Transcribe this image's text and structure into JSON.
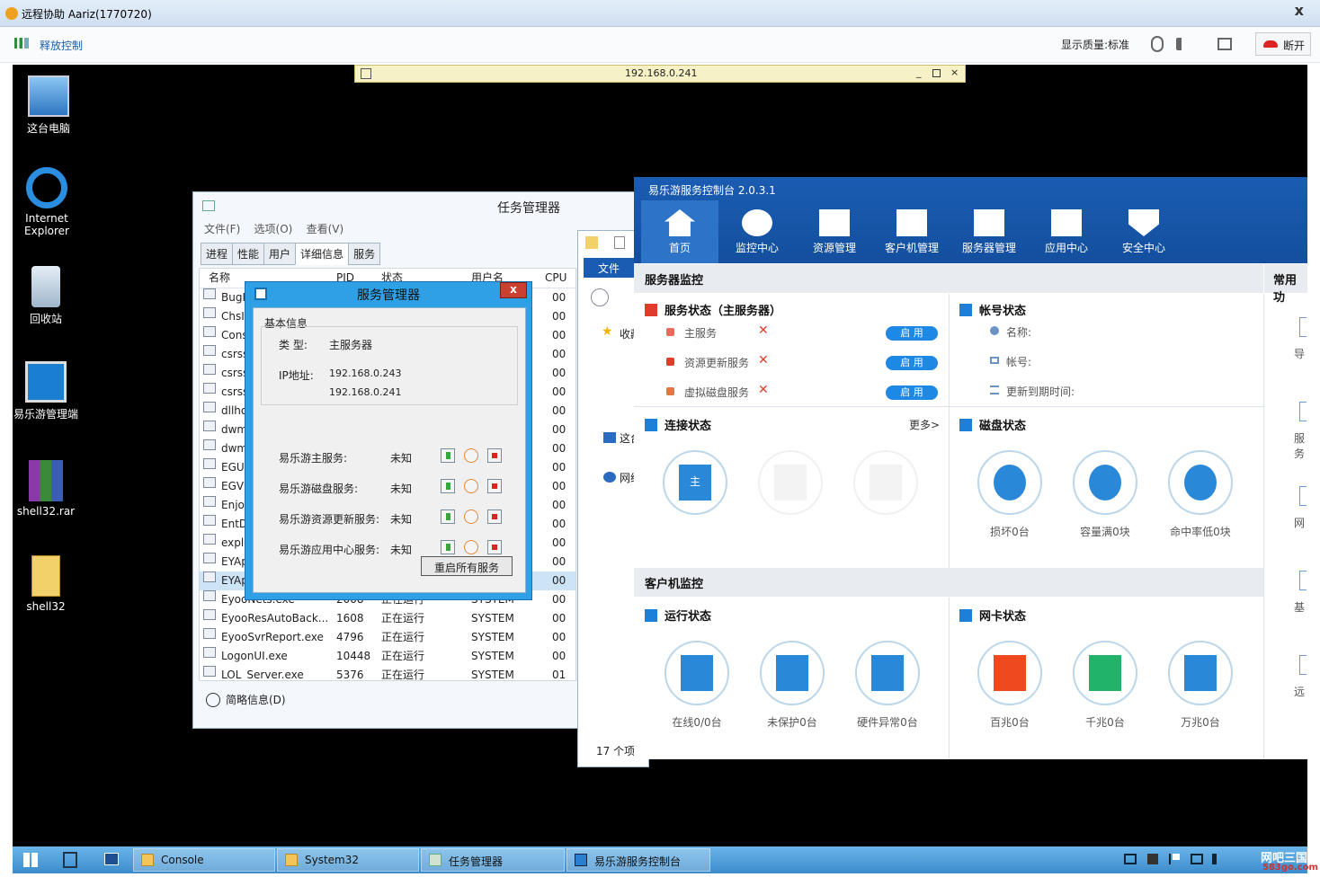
{
  "outer": {
    "title": "远程协助 Aariz(1770720)",
    "release_control": "释放控制",
    "quality": "显示质量:标准",
    "disconnect": "断开",
    "close": "x"
  },
  "remote_bar": {
    "address": "192.168.0.241"
  },
  "desktop_icons": [
    {
      "label": "这台电脑"
    },
    {
      "label": "Internet Explorer"
    },
    {
      "label": "回收站"
    },
    {
      "label": "易乐游管理端"
    },
    {
      "label": "shell32.rar"
    },
    {
      "label": "shell32"
    }
  ],
  "taskbar": {
    "items": [
      "Console",
      "System32",
      "任务管理器",
      "易乐游服务控制台"
    ],
    "watermark": "网吧三国",
    "watermark_url": "583go.com"
  },
  "task_manager": {
    "title": "任务管理器",
    "menu": [
      "文件(F)",
      "选项(O)",
      "查看(V)"
    ],
    "tabs": [
      "进程",
      "性能",
      "用户",
      "详细信息",
      "服务"
    ],
    "columns": [
      "名称",
      "PID",
      "状态",
      "用户名",
      "CPU"
    ],
    "rows": [
      {
        "name": "BugR",
        "pid": "",
        "status": "",
        "user": "",
        "cpu": "00"
      },
      {
        "name": "ChsII",
        "pid": "",
        "status": "",
        "user": "",
        "cpu": "00"
      },
      {
        "name": "Cons",
        "pid": "",
        "status": "",
        "user": "",
        "cpu": "00"
      },
      {
        "name": "csrss",
        "pid": "",
        "status": "",
        "user": "",
        "cpu": "00"
      },
      {
        "name": "csrss",
        "pid": "",
        "status": "",
        "user": "",
        "cpu": "00"
      },
      {
        "name": "csrss",
        "pid": "",
        "status": "",
        "user": "",
        "cpu": "00"
      },
      {
        "name": "dllho",
        "pid": "",
        "status": "",
        "user": "",
        "cpu": "00"
      },
      {
        "name": "dwm",
        "pid": "",
        "status": "",
        "user": "",
        "cpu": "00"
      },
      {
        "name": "dwm",
        "pid": "",
        "status": "",
        "user": "",
        "cpu": "00"
      },
      {
        "name": "EGUI",
        "pid": "",
        "status": "",
        "user": "",
        "cpu": "00"
      },
      {
        "name": "EGVi",
        "pid": "",
        "status": "",
        "user": "",
        "cpu": "00"
      },
      {
        "name": "Enjoy",
        "pid": "",
        "status": "",
        "user": "",
        "cpu": "00"
      },
      {
        "name": "EntD",
        "pid": "",
        "status": "",
        "user": "",
        "cpu": "00"
      },
      {
        "name": "explo",
        "pid": "",
        "status": "",
        "user": "",
        "cpu": "00"
      },
      {
        "name": "EYAp",
        "pid": "",
        "status": "",
        "user": "",
        "cpu": "00"
      },
      {
        "name": "EYAp",
        "pid": "",
        "status": "",
        "user": "",
        "cpu": "00"
      },
      {
        "name": "EyooNets.exe",
        "pid": "2008",
        "status": "正在运行",
        "user": "SYSTEM",
        "cpu": "00"
      },
      {
        "name": "EyooResAutoBack...",
        "pid": "1608",
        "status": "正在运行",
        "user": "SYSTEM",
        "cpu": "00"
      },
      {
        "name": "EyooSvrReport.exe",
        "pid": "4796",
        "status": "正在运行",
        "user": "SYSTEM",
        "cpu": "00"
      },
      {
        "name": "LogonUI.exe",
        "pid": "10448",
        "status": "正在运行",
        "user": "SYSTEM",
        "cpu": "00"
      },
      {
        "name": "LOL_Server.exe",
        "pid": "5376",
        "status": "正在运行",
        "user": "SYSTEM",
        "cpu": "01"
      }
    ],
    "footer": "简略信息(D)"
  },
  "service_manager": {
    "title": "服务管理器",
    "close": "x",
    "group_title": "基本信息",
    "type_label": "类 型:",
    "type_value": "主服务器",
    "ip_label": "IP地址:",
    "ip1": "192.168.0.243",
    "ip2": "192.168.0.241",
    "services": [
      {
        "name": "易乐游主服务:",
        "status": "未知"
      },
      {
        "name": "易乐游磁盘服务:",
        "status": "未知"
      },
      {
        "name": "易乐游资源更新服务:",
        "status": "未知"
      },
      {
        "name": "易乐游应用中心服务:",
        "status": "未知"
      }
    ],
    "restart_all": "重启所有服务"
  },
  "explorer": {
    "tab": "文件",
    "items": [
      "收藏",
      "这台",
      "网络"
    ],
    "count": "17 个项"
  },
  "console": {
    "title": "易乐游服务控制台 2.0.3.1",
    "nav": [
      "首页",
      "监控中心",
      "资源管理",
      "客户机管理",
      "服务器管理",
      "应用中心",
      "安全中心"
    ],
    "server_monitor": "服务器监控",
    "common_func": "常用功",
    "service_status": {
      "title": "服务状态（主服务器）",
      "items": [
        {
          "name": "主服务",
          "button": "启 用"
        },
        {
          "name": "资源更新服务",
          "button": "启 用"
        },
        {
          "name": "虚拟磁盘服务",
          "button": "启 用"
        }
      ]
    },
    "account_status": {
      "title": "帐号状态",
      "name_label": "名称:",
      "account_label": "帐号:",
      "expire_label": "更新到期时间:"
    },
    "connect_status": {
      "title": "连接状态",
      "more": "更多>",
      "main_label": "主"
    },
    "disk_status": {
      "title": "磁盘状态",
      "items": [
        "损坏0台",
        "容量满0块",
        "命中率低0块"
      ]
    },
    "client_monitor": "客户机监控",
    "run_status": {
      "title": "运行状态",
      "items": [
        "在线0/0台",
        "未保护0台",
        "硬件异常0台"
      ]
    },
    "nic_status": {
      "title": "网卡状态",
      "items": [
        "百兆0台",
        "千兆0台",
        "万兆0台"
      ]
    },
    "side_items": [
      "导",
      "服务",
      "网",
      "基",
      "远"
    ]
  }
}
